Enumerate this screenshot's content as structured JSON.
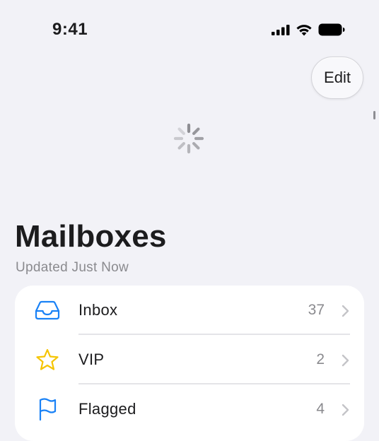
{
  "status_bar": {
    "time": "9:41",
    "icons": [
      "cellular-signal-icon",
      "wifi-icon",
      "battery-icon"
    ]
  },
  "navigation": {
    "edit_label": "Edit"
  },
  "header": {
    "title": "Mailboxes",
    "subtitle": "Updated Just Now"
  },
  "mailboxes": [
    {
      "label": "Inbox",
      "count": "37",
      "icon": "inbox-tray-icon",
      "color": "#1a82f6"
    },
    {
      "label": "VIP",
      "count": "2",
      "icon": "star-icon",
      "color": "#f5c400"
    },
    {
      "label": "Flagged",
      "count": "4",
      "icon": "flag-icon",
      "color": "#1a82f6"
    }
  ],
  "colors": {
    "background": "#f2f2f7",
    "accent_blue": "#1a82f6",
    "vip_yellow": "#f5c400",
    "secondary_text": "#8a8a8e"
  }
}
